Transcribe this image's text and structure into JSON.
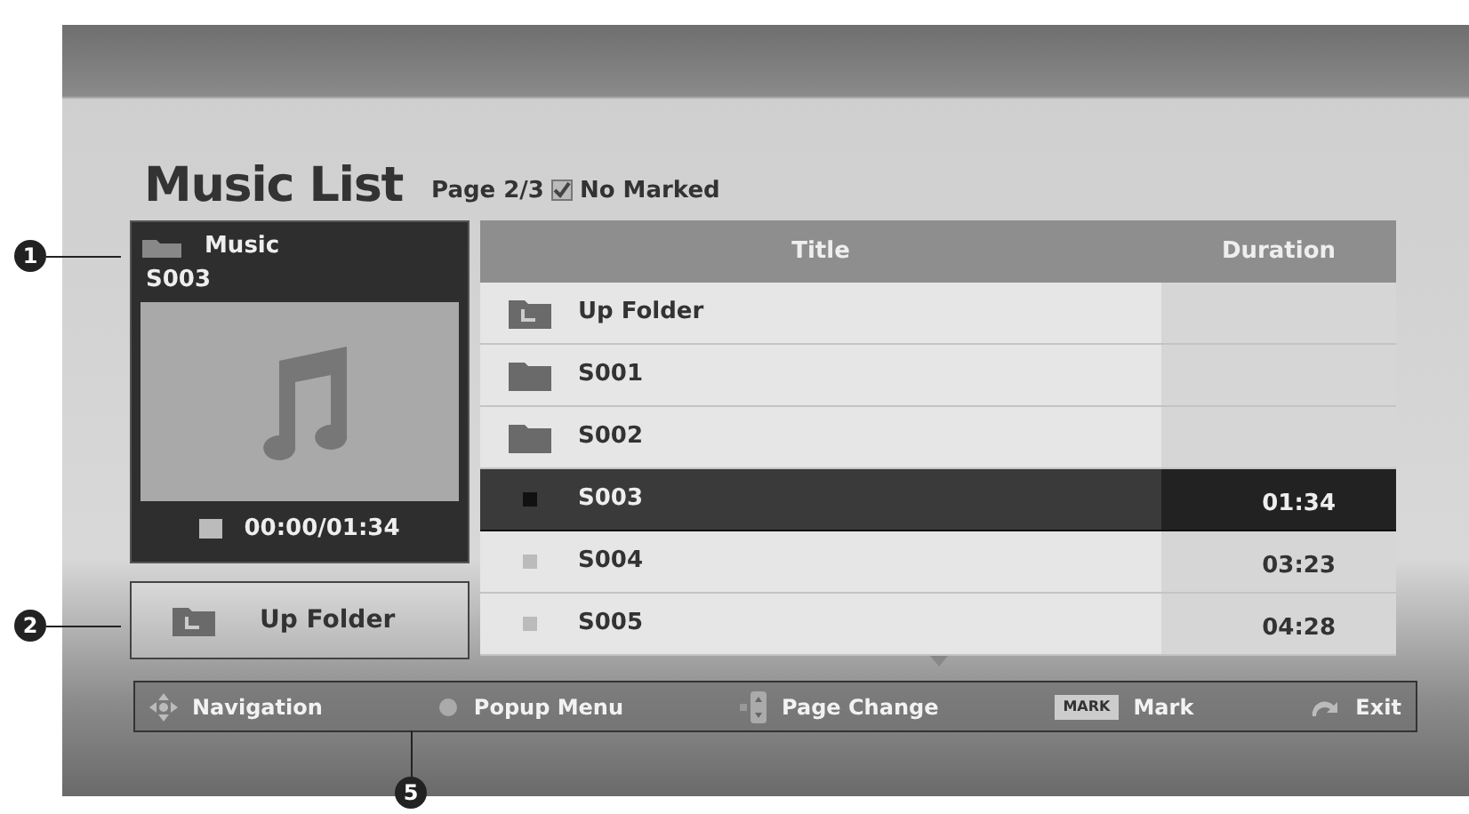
{
  "title": "Music List",
  "page": "Page 2/3",
  "marked": "No Marked",
  "preview": {
    "category": "Music",
    "track": "S003",
    "time": "00:00/01:34"
  },
  "up_folder_button": "Up Folder",
  "table": {
    "columns": [
      "Title",
      "Duration"
    ],
    "rows": [
      {
        "kind": "up",
        "title": "Up Folder",
        "duration": "",
        "selected": false
      },
      {
        "kind": "folder",
        "title": "S001",
        "duration": "",
        "selected": false
      },
      {
        "kind": "folder",
        "title": "S002",
        "duration": "",
        "selected": false
      },
      {
        "kind": "file",
        "title": "S003",
        "duration": "01:34",
        "selected": true
      },
      {
        "kind": "file",
        "title": "S004",
        "duration": "03:23",
        "selected": false
      },
      {
        "kind": "file",
        "title": "S005",
        "duration": "04:28",
        "selected": false
      }
    ]
  },
  "footer": [
    {
      "kind": "nav",
      "label": "Navigation"
    },
    {
      "kind": "dot",
      "label": "Popup Menu"
    },
    {
      "kind": "page",
      "label": "Page Change"
    },
    {
      "kind": "mark",
      "key": "MARK",
      "label": "Mark"
    },
    {
      "kind": "exit",
      "label": "Exit"
    }
  ],
  "callouts": [
    "1",
    "2",
    "5"
  ]
}
